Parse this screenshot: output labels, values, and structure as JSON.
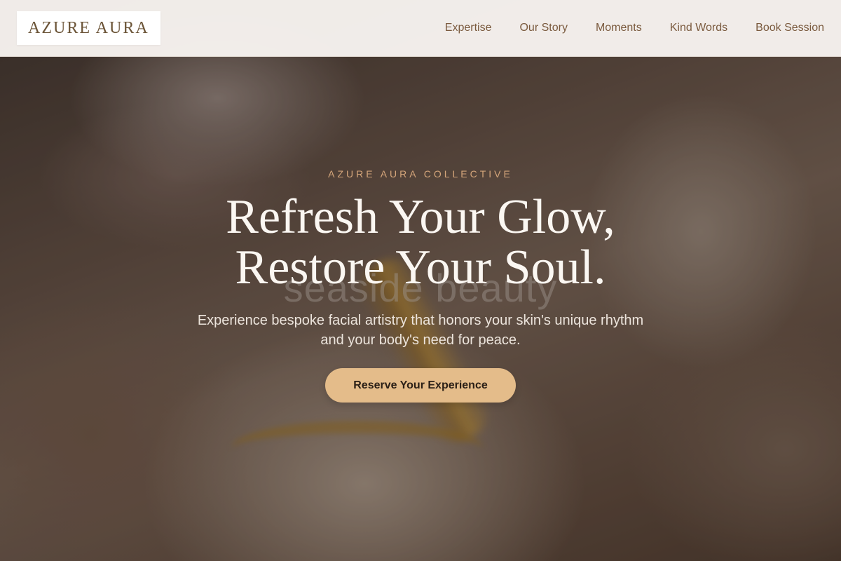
{
  "brand": {
    "logo_text": "AZURE AURA"
  },
  "nav": {
    "items": [
      {
        "label": "Expertise"
      },
      {
        "label": "Our Story"
      },
      {
        "label": "Moments"
      },
      {
        "label": "Kind Words"
      },
      {
        "label": "Book Session"
      }
    ]
  },
  "hero": {
    "eyebrow": "AZURE AURA COLLECTIVE",
    "headline_line1": "Refresh Your Glow,",
    "headline_line2": "Restore Your Soul.",
    "subtext": "Experience bespoke facial artistry that honors your skin's unique rhythm and your body's need for peace.",
    "cta_label": "Reserve Your Experience",
    "image_watermark": "seaside beauty"
  },
  "colors": {
    "header_bg": "#f8f4f0",
    "brand_text": "#6b5437",
    "nav_text": "#7a5a3e",
    "eyebrow": "#d4a57a",
    "headline": "#fbf7f2",
    "cta_bg": "#e4bc8a",
    "cta_text": "#2a1f16"
  }
}
